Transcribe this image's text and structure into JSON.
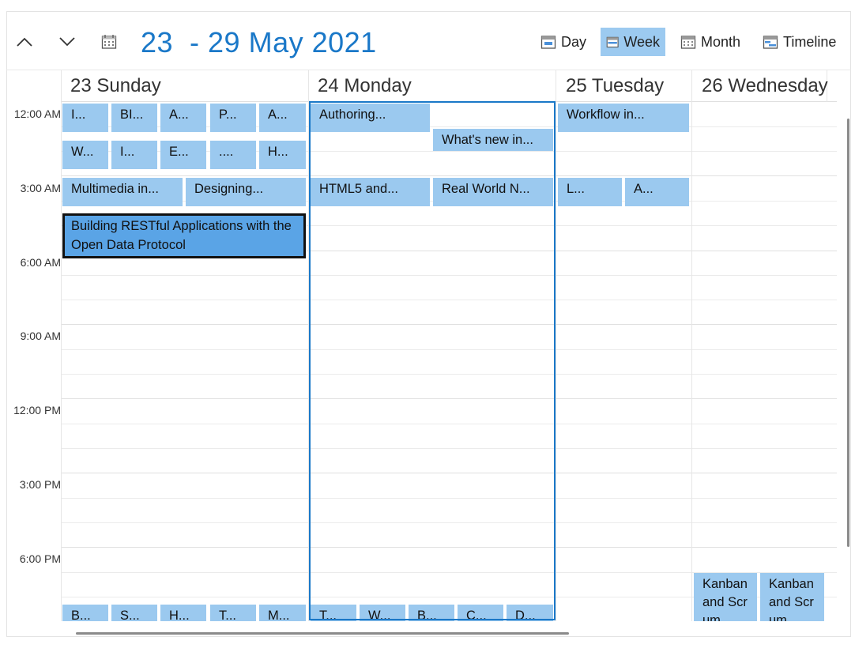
{
  "toolbar": {
    "date_range": "23  - 29 May 2021",
    "views": [
      {
        "label": "Day",
        "icon": "calendar-day-icon",
        "active": false
      },
      {
        "label": "Week",
        "icon": "calendar-week-icon",
        "active": true
      },
      {
        "label": "Month",
        "icon": "calendar-month-icon",
        "active": false
      },
      {
        "label": "Timeline",
        "icon": "calendar-timeline-icon",
        "active": false
      }
    ]
  },
  "days": [
    {
      "label": "23 Sunday"
    },
    {
      "label": "24 Monday"
    },
    {
      "label": "25 Tuesday"
    },
    {
      "label": "26 Wednesday"
    }
  ],
  "time_labels": [
    "12:00 AM",
    "3:00 AM",
    "6:00 AM",
    "9:00 AM",
    "12:00 PM",
    "3:00 PM",
    "6:00 PM"
  ],
  "appointments": {
    "sunday_row1": [
      "I...",
      "BI...",
      "A...",
      "P...",
      "A..."
    ],
    "sunday_row2": [
      "W...",
      "I...",
      "E...",
      "....",
      "H..."
    ],
    "sunday_row3": [
      "Multimedia in...",
      "Designing..."
    ],
    "sunday_selected": "Building RESTful Applications with the Open Data Protocol",
    "sunday_bottom": [
      "B...",
      "S...",
      "H...",
      "T...",
      "M..."
    ],
    "monday_row1": [
      "Authoring..."
    ],
    "monday_row2": [
      "What's new in..."
    ],
    "monday_row3": [
      "HTML5 and...",
      "Real World N..."
    ],
    "monday_bottom": [
      "T...",
      "W...",
      "B...",
      "C...",
      "D..."
    ],
    "tuesday_row1": [
      "Workflow in..."
    ],
    "tuesday_row3": [
      "L...",
      "A..."
    ],
    "wednesday_bottom": [
      "Kanban and Scrum",
      "Kanban and Scrum"
    ]
  },
  "colors": {
    "accent": "#1a78c8",
    "appointment": "#9bc9ef",
    "selected_appointment": "#5aa4e6",
    "active_view": "#9ccaf0"
  }
}
